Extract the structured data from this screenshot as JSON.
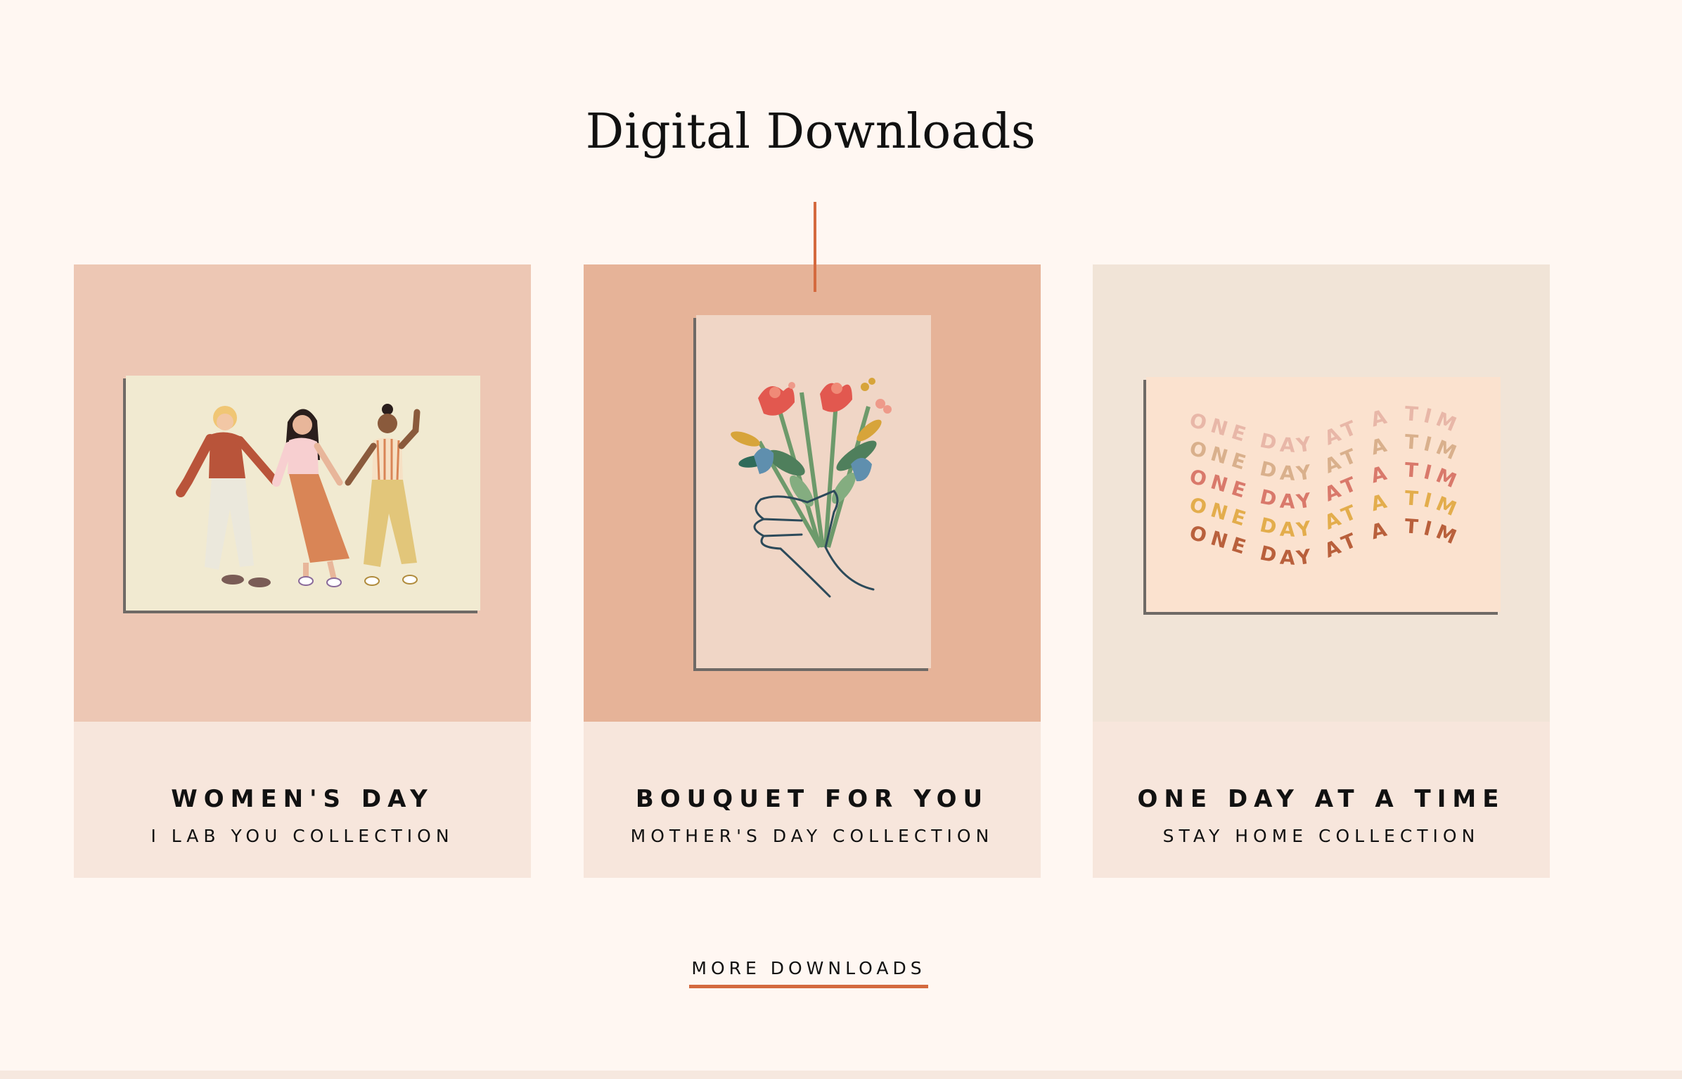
{
  "section": {
    "heading": "Digital Downloads"
  },
  "cards": [
    {
      "title": "WOMEN'S DAY",
      "subtitle": "I LAB YOU COLLECTION",
      "artwork": "three-women-dancing-illustration"
    },
    {
      "title": "BOUQUET FOR YOU",
      "subtitle": "MOTHER'S DAY COLLECTION",
      "artwork": "hand-holding-flower-bouquet-illustration"
    },
    {
      "title": "ONE DAY AT A TIME",
      "subtitle": "STAY HOME COLLECTION",
      "artwork": "wavy-typography-print",
      "print_text": "ONE DAY AT A TIME."
    }
  ],
  "more_link": {
    "label": "MORE DOWNLOADS"
  },
  "colors": {
    "background": "#fff7f2",
    "accent": "#d46a3f",
    "card_info_bg": "#f7e6dc"
  }
}
